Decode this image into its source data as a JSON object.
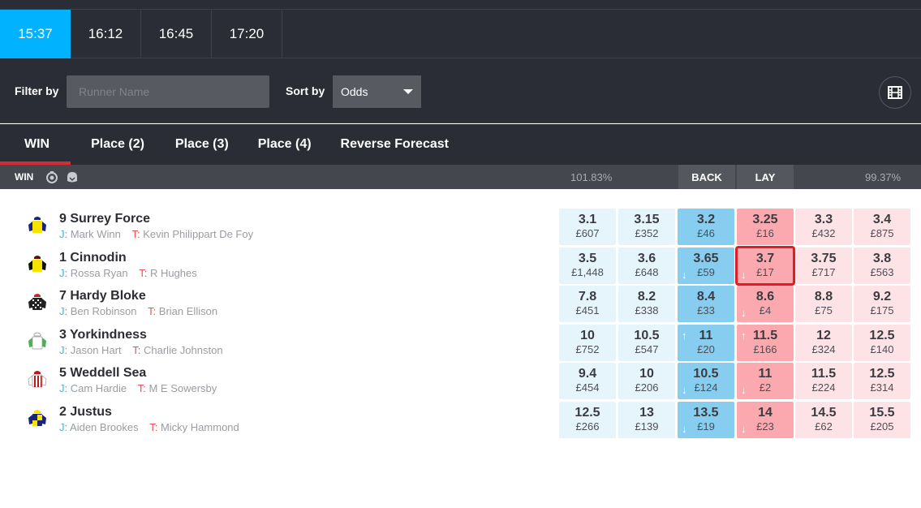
{
  "race_times": [
    {
      "label": "15:37",
      "active": true
    },
    {
      "label": "16:12",
      "active": false
    },
    {
      "label": "16:45",
      "active": false
    },
    {
      "label": "17:20",
      "active": false
    }
  ],
  "filter": {
    "filter_label": "Filter by",
    "runner_placeholder": "Runner Name",
    "runner_value": "",
    "sort_label": "Sort by",
    "sort_value": "Odds",
    "video_icon": "film-icon"
  },
  "market_tabs": [
    {
      "label": "WIN",
      "active": true
    },
    {
      "label": "Place (2)",
      "active": false
    },
    {
      "label": "Place (3)",
      "active": false
    },
    {
      "label": "Place (4)",
      "active": false
    },
    {
      "label": "Reverse Forecast",
      "active": false
    }
  ],
  "subheader": {
    "market": "WIN",
    "icons": [
      "stopwatch-icon",
      "helmet-icon"
    ],
    "back_overround": "101.83%",
    "back_label": "BACK",
    "lay_label": "LAY",
    "lay_overround": "99.37%"
  },
  "colors": {
    "accent": "#00b2ff",
    "active_tab_underline": "#d42b35",
    "back_best": "#87cdef",
    "back_other": "#e6f4fb",
    "lay_best": "#fba9ae",
    "lay_other": "#fde3e5",
    "selected_outline": "#e31b23",
    "jockey_label": "#3cb4e5",
    "trainer_label": "#ec4d57"
  },
  "runners": [
    {
      "name": "9 Surrey Force",
      "jockey_label": "J:",
      "jockey": "Mark Winn",
      "trainer_label": "T:",
      "trainer": "Kevin Philippart De Foy",
      "silk": {
        "body": "#f5e400",
        "sleeves": "#1a237e",
        "cap": "#1a237e",
        "pattern": "plain"
      },
      "prices": [
        {
          "odds": "3.1",
          "stake": "£607",
          "side": "back"
        },
        {
          "odds": "3.15",
          "stake": "£352",
          "side": "back"
        },
        {
          "odds": "3.2",
          "stake": "£46",
          "side": "back"
        },
        {
          "odds": "3.25",
          "stake": "£16",
          "side": "lay"
        },
        {
          "odds": "3.3",
          "stake": "£432",
          "side": "lay"
        },
        {
          "odds": "3.4",
          "stake": "£875",
          "side": "lay"
        }
      ]
    },
    {
      "name": "1 Cinnodin",
      "jockey_label": "J:",
      "jockey": "Rossa Ryan",
      "trainer_label": "T:",
      "trainer": "R Hughes",
      "silk": {
        "body": "#f5e400",
        "sleeves": "#111111",
        "cap": "#5a1010",
        "pattern": "plain"
      },
      "prices": [
        {
          "odds": "3.5",
          "stake": "£1,448",
          "side": "back"
        },
        {
          "odds": "3.6",
          "stake": "£648",
          "side": "back"
        },
        {
          "odds": "3.65",
          "stake": "£59",
          "side": "back",
          "trend": "down"
        },
        {
          "odds": "3.7",
          "stake": "£17",
          "side": "lay",
          "trend": "down",
          "selected": true
        },
        {
          "odds": "3.75",
          "stake": "£717",
          "side": "lay"
        },
        {
          "odds": "3.8",
          "stake": "£563",
          "side": "lay"
        }
      ]
    },
    {
      "name": "7 Hardy Bloke",
      "jockey_label": "J:",
      "jockey": "Ben Robinson",
      "trainer_label": "T:",
      "trainer": "Brian Ellison",
      "silk": {
        "body": "#222222",
        "sleeves": "#222222",
        "cap": "#c62828",
        "pattern": "check-white"
      },
      "prices": [
        {
          "odds": "7.8",
          "stake": "£451",
          "side": "back"
        },
        {
          "odds": "8.2",
          "stake": "£338",
          "side": "back"
        },
        {
          "odds": "8.4",
          "stake": "£33",
          "side": "back"
        },
        {
          "odds": "8.6",
          "stake": "£4",
          "side": "lay",
          "trend": "down"
        },
        {
          "odds": "8.8",
          "stake": "£75",
          "side": "lay"
        },
        {
          "odds": "9.2",
          "stake": "£175",
          "side": "lay"
        }
      ]
    },
    {
      "name": "3 Yorkindness",
      "jockey_label": "J:",
      "jockey": "Jason Hart",
      "trainer_label": "T:",
      "trainer": "Charlie Johnston",
      "silk": {
        "body": "#ffffff",
        "sleeves": "#4caf50",
        "cap": "#ffffff",
        "pattern": "plain"
      },
      "prices": [
        {
          "odds": "10",
          "stake": "£752",
          "side": "back"
        },
        {
          "odds": "10.5",
          "stake": "£547",
          "side": "back"
        },
        {
          "odds": "11",
          "stake": "£20",
          "side": "back",
          "trend": "up"
        },
        {
          "odds": "11.5",
          "stake": "£166",
          "side": "lay",
          "trend": "up"
        },
        {
          "odds": "12",
          "stake": "£324",
          "side": "lay"
        },
        {
          "odds": "12.5",
          "stake": "£140",
          "side": "lay"
        }
      ]
    },
    {
      "name": "5 Weddell Sea",
      "jockey_label": "J:",
      "jockey": "Cam Hardie",
      "trainer_label": "T:",
      "trainer": "M E Sowersby",
      "silk": {
        "body": "#ffffff",
        "sleeves": "#ffffff",
        "cap": "#b71c1c",
        "pattern": "stripes-red"
      },
      "prices": [
        {
          "odds": "9.4",
          "stake": "£454",
          "side": "back"
        },
        {
          "odds": "10",
          "stake": "£206",
          "side": "back"
        },
        {
          "odds": "10.5",
          "stake": "£124",
          "side": "back",
          "trend": "down"
        },
        {
          "odds": "11",
          "stake": "£2",
          "side": "lay",
          "trend": "down"
        },
        {
          "odds": "11.5",
          "stake": "£224",
          "side": "lay"
        },
        {
          "odds": "12.5",
          "stake": "£314",
          "side": "lay"
        }
      ]
    },
    {
      "name": "2 Justus",
      "jockey_label": "J:",
      "jockey": "Aiden Brookes",
      "trainer_label": "T:",
      "trainer": "Micky Hammond",
      "silk": {
        "body": "#1a237e",
        "sleeves": "#1a237e",
        "cap": "#f5e400",
        "pattern": "quarters-yellow"
      },
      "prices": [
        {
          "odds": "12.5",
          "stake": "£266",
          "side": "back"
        },
        {
          "odds": "13",
          "stake": "£139",
          "side": "back"
        },
        {
          "odds": "13.5",
          "stake": "£19",
          "side": "back",
          "trend": "down"
        },
        {
          "odds": "14",
          "stake": "£23",
          "side": "lay",
          "trend": "down"
        },
        {
          "odds": "14.5",
          "stake": "£62",
          "side": "lay"
        },
        {
          "odds": "15.5",
          "stake": "£205",
          "side": "lay"
        }
      ]
    }
  ]
}
